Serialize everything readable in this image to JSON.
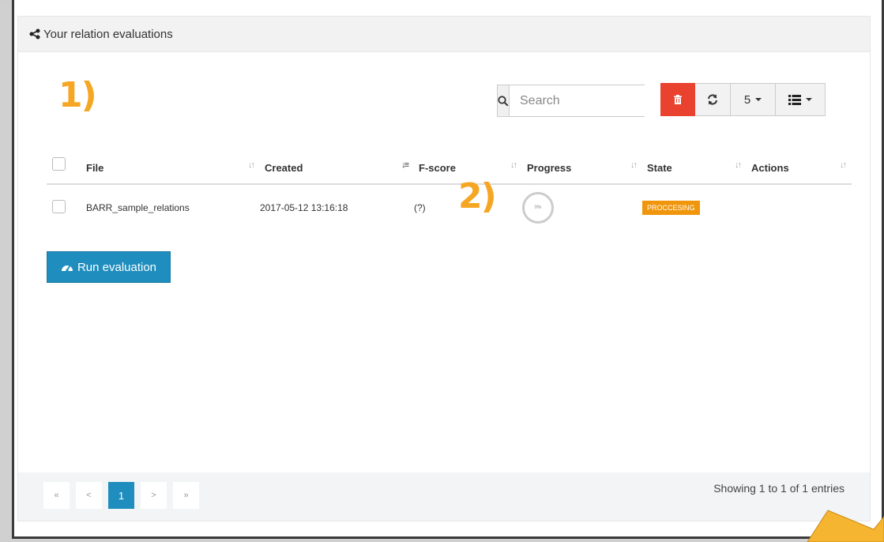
{
  "panel": {
    "title": "Your relation evaluations"
  },
  "annotations": {
    "a1": "1)",
    "a2": "2)"
  },
  "toolbar": {
    "search_placeholder": "Search",
    "page_size": "5"
  },
  "table": {
    "headers": [
      "File",
      "Created",
      "F-score",
      "Progress",
      "State",
      "Actions"
    ],
    "rows": [
      {
        "file": "BARR_sample_relations",
        "created": "2017-05-12 13:16:18",
        "fscore": "(?)",
        "progress": "0%",
        "state": "PROCCESING",
        "actions": ""
      }
    ]
  },
  "run_button": {
    "label": "Run evaluation"
  },
  "pagination": {
    "first": "«",
    "prev": "<",
    "current": "1",
    "next": ">",
    "last": "»"
  },
  "entries_text": "Showing 1 to 1 of 1 entries",
  "colors": {
    "accent": "#1f8dbd",
    "danger": "#e9422e",
    "warning": "#f0960c",
    "annotation": "#f5a623"
  },
  "icons": [
    "share-icon",
    "search-icon",
    "trash-icon",
    "refresh-icon",
    "list-icon",
    "dashboard-icon"
  ]
}
